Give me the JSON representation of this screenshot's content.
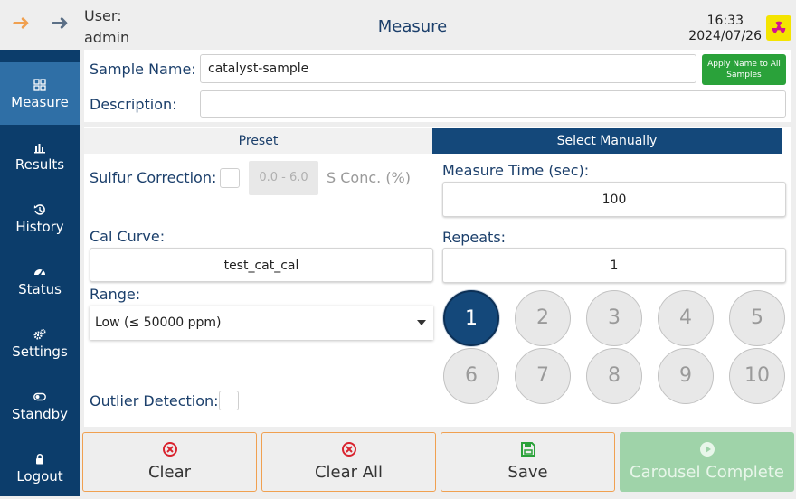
{
  "header": {
    "user_label": "User:",
    "user_name": "admin",
    "title": "Measure",
    "time": "16:33",
    "date": "2024/07/26"
  },
  "sidebar": {
    "items": [
      {
        "label": "Measure",
        "icon": "measure-icon",
        "active": true
      },
      {
        "label": "Results",
        "icon": "bar-chart-icon"
      },
      {
        "label": "History",
        "icon": "history-icon"
      },
      {
        "label": "Status",
        "icon": "gauge-icon"
      },
      {
        "label": "Settings",
        "icon": "gears-icon"
      },
      {
        "label": "Standby",
        "icon": "toggle-icon"
      },
      {
        "label": "Logout",
        "icon": "lock-icon"
      }
    ]
  },
  "sample": {
    "name_label": "Sample Name:",
    "name_value": "catalyst-sample",
    "apply_button_label": "Apply Name to All Samples",
    "description_label": "Description:",
    "description_value": ""
  },
  "tabs": {
    "preset": "Preset",
    "manual": "Select Manually"
  },
  "left": {
    "sulfur_label": "Sulfur Correction:",
    "sulfur_range": "0.0 - 6.0",
    "sulfur_unit": "S Conc. (%)",
    "cal_curve_label": "Cal Curve:",
    "cal_curve_value": "test_cat_cal",
    "range_label": "Range:",
    "range_value": "Low (≤ 50000 ppm)",
    "outlier_label": "Outlier Detection:"
  },
  "right": {
    "measure_time_label": "Measure Time (sec):",
    "measure_time_value": "100",
    "repeats_label": "Repeats:",
    "repeats_value": "1",
    "positions": [
      "1",
      "2",
      "3",
      "4",
      "5",
      "6",
      "7",
      "8",
      "9",
      "10"
    ],
    "selected_position": "1"
  },
  "buttons": {
    "clear": "Clear",
    "clear_all": "Clear All",
    "save": "Save",
    "carousel": "Carousel Complete"
  },
  "colors": {
    "sidebar": "#0c3d6b",
    "sidebar_active": "#2f6fa6",
    "accent": "#14487a",
    "apply_green": "#2aa23a",
    "done_green": "#9fd3a9",
    "button_border": "#f0a050",
    "danger": "#d9232e"
  }
}
